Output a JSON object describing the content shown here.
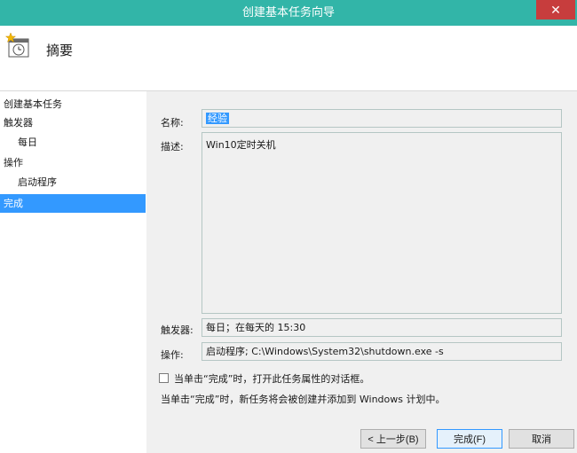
{
  "window": {
    "title": "创建基本任务向导",
    "close_glyph": "✕",
    "accent_color": "#32b5a8",
    "close_color": "#c73d3d",
    "selection_color": "#3399ff"
  },
  "header": {
    "title": "摘要",
    "icon": "task-clock-icon"
  },
  "sidebar": {
    "items": [
      {
        "label": "创建基本任务",
        "sub": false,
        "active": false
      },
      {
        "label": "触发器",
        "sub": false,
        "active": false
      },
      {
        "label": "每日",
        "sub": true,
        "active": false
      },
      {
        "label": "操作",
        "sub": false,
        "active": false
      },
      {
        "label": "启动程序",
        "sub": true,
        "active": false
      },
      {
        "label": "完成",
        "sub": false,
        "active": true
      }
    ]
  },
  "form": {
    "name_label": "名称:",
    "name_value": "经验",
    "description_label": "描述:",
    "description_value": "Win10定时关机",
    "trigger_label": "触发器:",
    "trigger_value": "每日；在每天的 15:30",
    "action_label": "操作:",
    "action_value": "启动程序; C:\\Windows\\System32\\shutdown.exe -s",
    "open_properties_checkbox_label": "当单击“完成”时，打开此任务属性的对话框。",
    "open_properties_checked": false,
    "finish_note": "当单击“完成”时，新任务将会被创建并添加到 Windows 计划中。"
  },
  "buttons": {
    "back": "< 上一步(B)",
    "finish": "完成(F)",
    "cancel": "取消"
  }
}
